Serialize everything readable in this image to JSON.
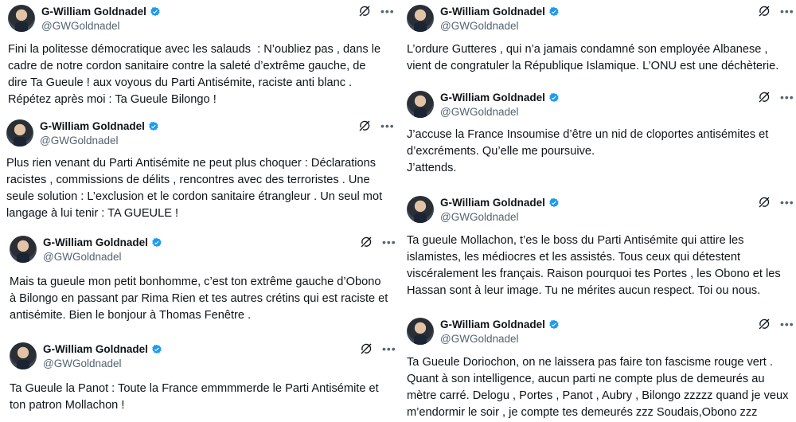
{
  "author": {
    "name": "G-William Goldnadel",
    "handle": "@GWGoldnadel"
  },
  "tweets": [
    {
      "text": "Fini la politesse démocratique avec les salauds  : N’oubliez pas , dans le\ncadre de notre cordon sanitaire contre la saleté d’extrême gauche, de\ndire Ta Gueule ! aux voyous du Parti Antisémite, raciste anti blanc .\nRépétez après moi : Ta Gueule Bilongo !"
    },
    {
      "text": "Plus rien venant du Parti Antisémite ne peut plus choquer : Déclarations\nracistes , commissions de délits , rencontres avec des terroristes . Une\nseule solution : L’exclusion et le cordon sanitaire étrangleur . Un seul mot\nlangage à lui tenir : TA GUEULE !"
    },
    {
      "text": "Mais ta gueule mon petit bonhomme, c’est ton extrême gauche d’Obono\nà Bilongo en passant par Rima Rien et tes autres crétins qui est raciste et\nantisémite. Bien le bonjour à Thomas Fenêtre ."
    },
    {
      "text": "Ta Gueule la Panot : Toute la France emmmmerde le Parti Antisémite et\nton patron Mollachon !"
    },
    {
      "text": "L’ordure Gutteres , qui n’a jamais condamné son employée Albanese ,\nvient de congratuler la République Islamique. L’ONU est une déchèterie."
    },
    {
      "text": "J’accuse la France Insoumise d’être un nid de cloportes antisémites et\nd’excréments. Qu’elle me poursuive.\nJ’attends."
    },
    {
      "text": "Ta gueule Mollachon, t’es le boss du Parti Antisémite qui attire les\nislamistes, les médiocres et les assistés. Tous ceux qui détestent\nviscéralement les français. Raison pourquoi tes Portes , les Obono et les\nHassan sont à leur image. Tu ne mérites aucun respect. Toi ou nous."
    },
    {
      "text": "Ta Gueule Doriochon, on ne laissera pas faire ton fascisme rouge vert .\nQuant à son intelligence, aucun parti ne compte plus de demeurés au\nmètre carré. Delogu , Portes , Panot , Aubry , Bilongo zzzzz quand je veux\nm’endormir le soir , je compte tes demeurés zzz Soudais,Obono zzz"
    }
  ],
  "icons": {
    "verified": "verified-badge-icon",
    "grok": "grok-icon",
    "more": "more-icon"
  },
  "colors": {
    "verified": "#1d9bf0",
    "handle": "#536471"
  }
}
